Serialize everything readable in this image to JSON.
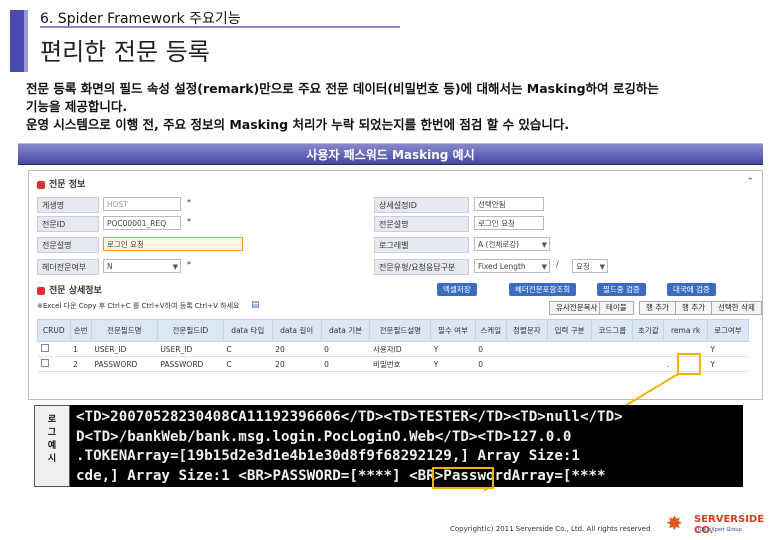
{
  "header": {
    "chapter": "6. Spider Framework 주요기능",
    "title": "편리한 전문 등록"
  },
  "description": {
    "line1": "전문 등록 화면의 필드 속성 설정(remark)만으로 주요 전문 데이터(비밀번호 등)에 대해서는 Masking하여 로깅하는",
    "line2": "기능을 제공합니다.",
    "line3": "운영 시스템으로 이행 전, 주요 정보의 Masking 처리가 누락 되었는지를 한번에 점검 할 수 있습니다."
  },
  "caption": "사용자 패스워드 Masking 예시",
  "screen": {
    "section1": "전문 정보",
    "form": [
      {
        "label": "게생명",
        "value": "HOST",
        "mark": "*"
      },
      {
        "label": "전문ID",
        "value": "POC00001_REQ",
        "mark": "*"
      },
      {
        "label": "전문설명",
        "value": "로그인 요청",
        "mark": ""
      },
      {
        "label": "헤더전문여부",
        "value": "N",
        "mark": "*"
      }
    ],
    "form_right": [
      {
        "label": "상세설정ID",
        "value": "선택안됨"
      },
      {
        "label": "전문설명",
        "value": "로그인 요청"
      },
      {
        "label": "로그레벨",
        "value": "A (전체로깅)"
      },
      {
        "label": "전문유형/요청응답구분",
        "value": "Fixed Length",
        "value2": "요청"
      }
    ],
    "section2": "전문 상세정보",
    "hint": "※Excel 다운 Copy 후 Ctrl+C 를 Ctrl+V하여 등록 Ctrl+V 하세요",
    "buttons_top": [
      "엑셀저장",
      "헤더전문포함조회",
      "필드중 검증",
      "대국에 검증"
    ],
    "buttons_bottom": [
      "유사전문복사",
      "테이블",
      "행 추가",
      "행 추가",
      "선택한 삭제"
    ],
    "columns": [
      "CRUD",
      "순번",
      "전문필드명",
      "전문필드ID",
      "data 타입",
      "data 길이",
      "data 기본",
      "전문필드설명",
      "필수 여부",
      "스케일",
      "정렬문자",
      "입력 구분",
      "코드그룹",
      "초기값",
      "rema rk",
      "로그여부"
    ],
    "rows": [
      {
        "seq": "1",
        "name": "USER_ID",
        "id": "USER_ID",
        "type": "C",
        "len": "20",
        "base": "0",
        "desc": "사용자ID",
        "req": "Y",
        "scale": "0",
        "remark": "",
        "log": "Y"
      },
      {
        "seq": "2",
        "name": "PASSWORD",
        "id": "PASSWORD",
        "type": "C",
        "len": "20",
        "base": "0",
        "desc": "비밀번호",
        "req": "Y",
        "scale": "0",
        "remark": ".",
        "log": "Y"
      }
    ]
  },
  "log_label": "로\n그\n예\n시",
  "log_lines": [
    "<TD>20070528230408CA11192396606</TD><TD>TESTER</TD><TD>null</TD>",
    "D<TD>/bankWeb/bank.msg.login.PocLoginO.Web</TD><TD>127.0.0",
    ".TOKENArray=[19b15d2e3d1e4b1e30d8f9f68292129,] Array Size:1",
    "cde,] Array Size:1 <BR>PASSWORD=[****] <BR>PasswordArray=[****"
  ],
  "footer": "Copyright(c) 2011 Serverside Co., Ltd. All rights reserved",
  "logo": {
    "name": "SERVERSIDE CO.",
    "sub": "JDK eXpert Group"
  },
  "colors": {
    "accent": "#4a4ab0",
    "highlight": "#f2b400",
    "logo": "#d0401c"
  }
}
